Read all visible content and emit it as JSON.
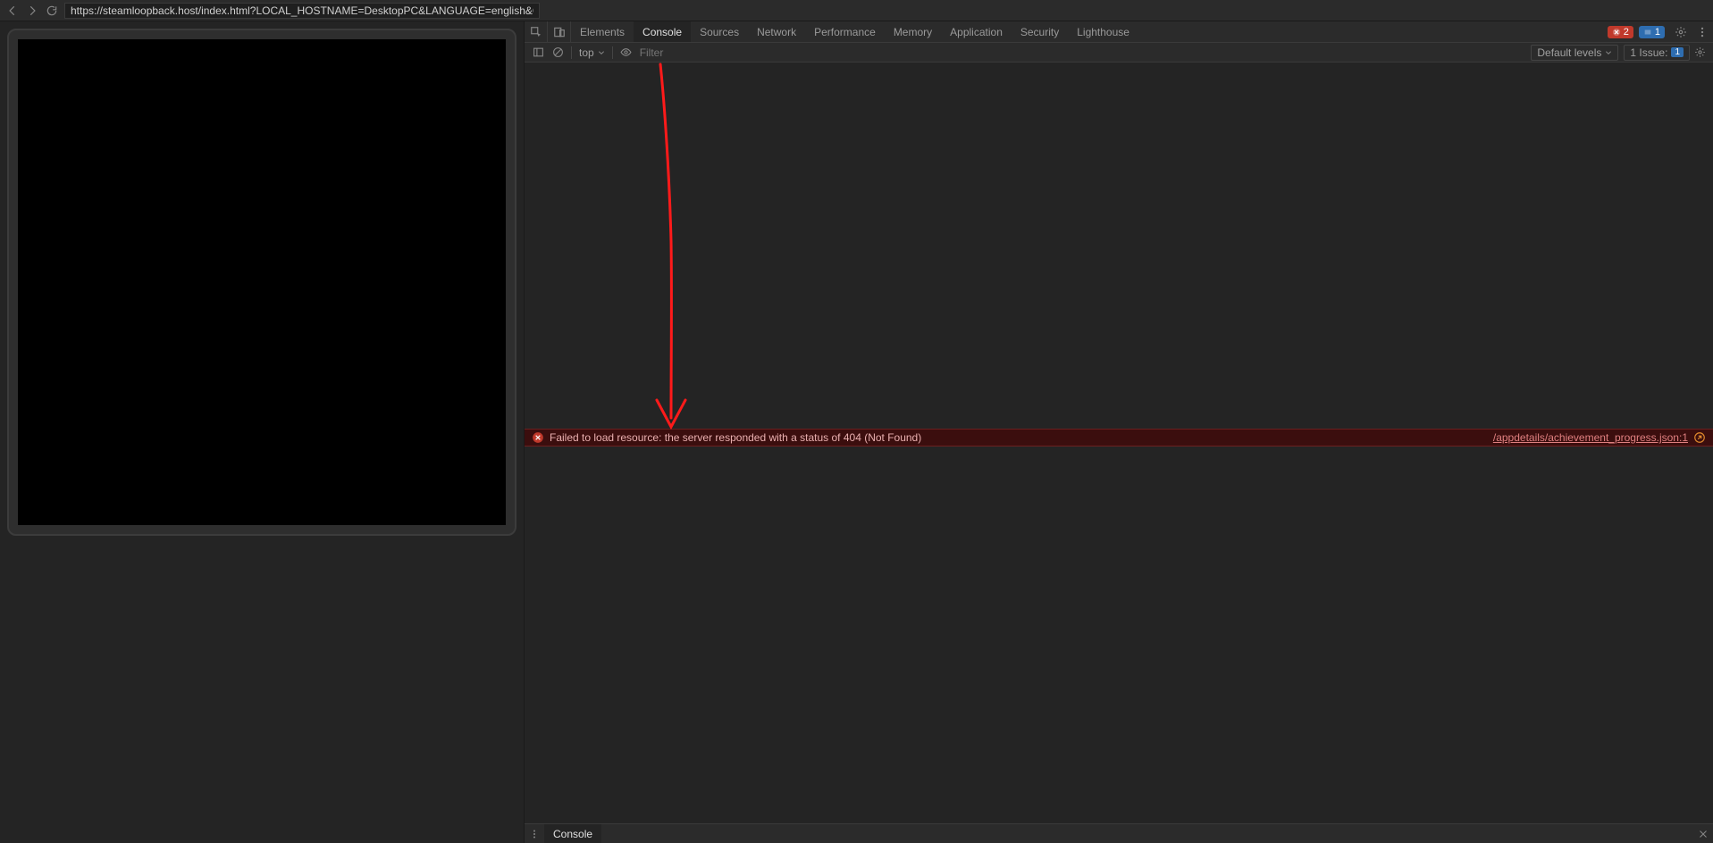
{
  "address_bar": {
    "url": "https://steamloopback.host/index.html?LOCAL_HOSTNAME=DesktopPC&LANGUAGE=english&COUNTRY=CA&LAUNC"
  },
  "devtools_tabs": {
    "items": [
      "Elements",
      "Console",
      "Sources",
      "Network",
      "Performance",
      "Memory",
      "Application",
      "Security",
      "Lighthouse"
    ],
    "active_index": 1
  },
  "badges": {
    "error_count": "2",
    "info_count": "1"
  },
  "console_toolbar": {
    "context": "top",
    "filter_placeholder": "Filter",
    "levels_label": "Default levels",
    "issues_label": "1 Issue:",
    "issues_count": "1"
  },
  "console_error": {
    "message": "Failed to load resource: the server responded with a status of 404 (Not Found)",
    "source": "/appdetails/achievement_progress.json:1"
  },
  "drawer": {
    "tab_label": "Console"
  }
}
